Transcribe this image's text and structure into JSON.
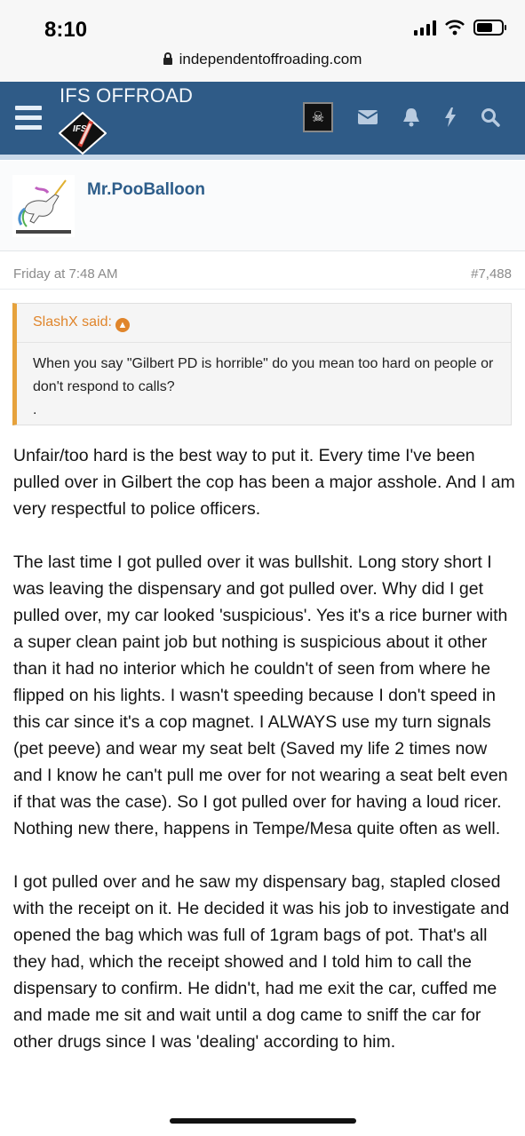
{
  "status_bar": {
    "time": "8:10"
  },
  "browser": {
    "url": "independentoffroading.com"
  },
  "header": {
    "site_title": "IFS OFFROAD",
    "logo_text": "IFS",
    "icons": [
      "menu-icon",
      "pirate-flag-icon",
      "envelope-icon",
      "bell-icon",
      "lightning-icon",
      "search-icon"
    ]
  },
  "post": {
    "username": "Mr.PooBalloon",
    "date": "Friday at 7:48 AM",
    "post_number": "#7,488",
    "quote": {
      "author_line": "SlashX said:",
      "text": "When you say \"Gilbert PD is horrible\" do you mean too hard on people or don't respond to calls?",
      "trail": "."
    },
    "paragraphs": [
      "Unfair/too hard is the best way to put it. Every time I've been pulled over in Gilbert the cop has been a major asshole. And I am very respectful to police officers.",
      "The last time I got pulled over it was bullshit. Long story short I was leaving the dispensary and got pulled over. Why did I get pulled over, my car looked 'suspicious'. Yes it's a rice burner with a super clean paint job but nothing is suspicious about it other than it had no interior which he couldn't of seen from where he flipped on his lights. I wasn't speeding because I don't speed in this car since it's a cop magnet. I ALWAYS use my turn signals (pet peeve) and wear my seat belt (Saved my life 2 times now and I know he can't pull me over for not wearing a seat belt even if that was the case). So I got pulled over for having a loud ricer. Nothing new there, happens in Tempe/Mesa quite often as well.",
      "I got pulled over and he saw my dispensary bag, stapled closed with the receipt on it. He decided it was his job to investigate and opened the bag which was full of 1gram bags of pot. That's all they had, which the receipt showed and I told him to call the dispensary to confirm. He didn't, had me exit the car, cuffed me and made me sit and wait until a dog came to sniff the car for other drugs since I was 'dealing' according to him."
    ]
  },
  "colors": {
    "nav_bg": "#2f5b87",
    "username": "#2d5d8a",
    "quote_accent": "#e0852b"
  }
}
